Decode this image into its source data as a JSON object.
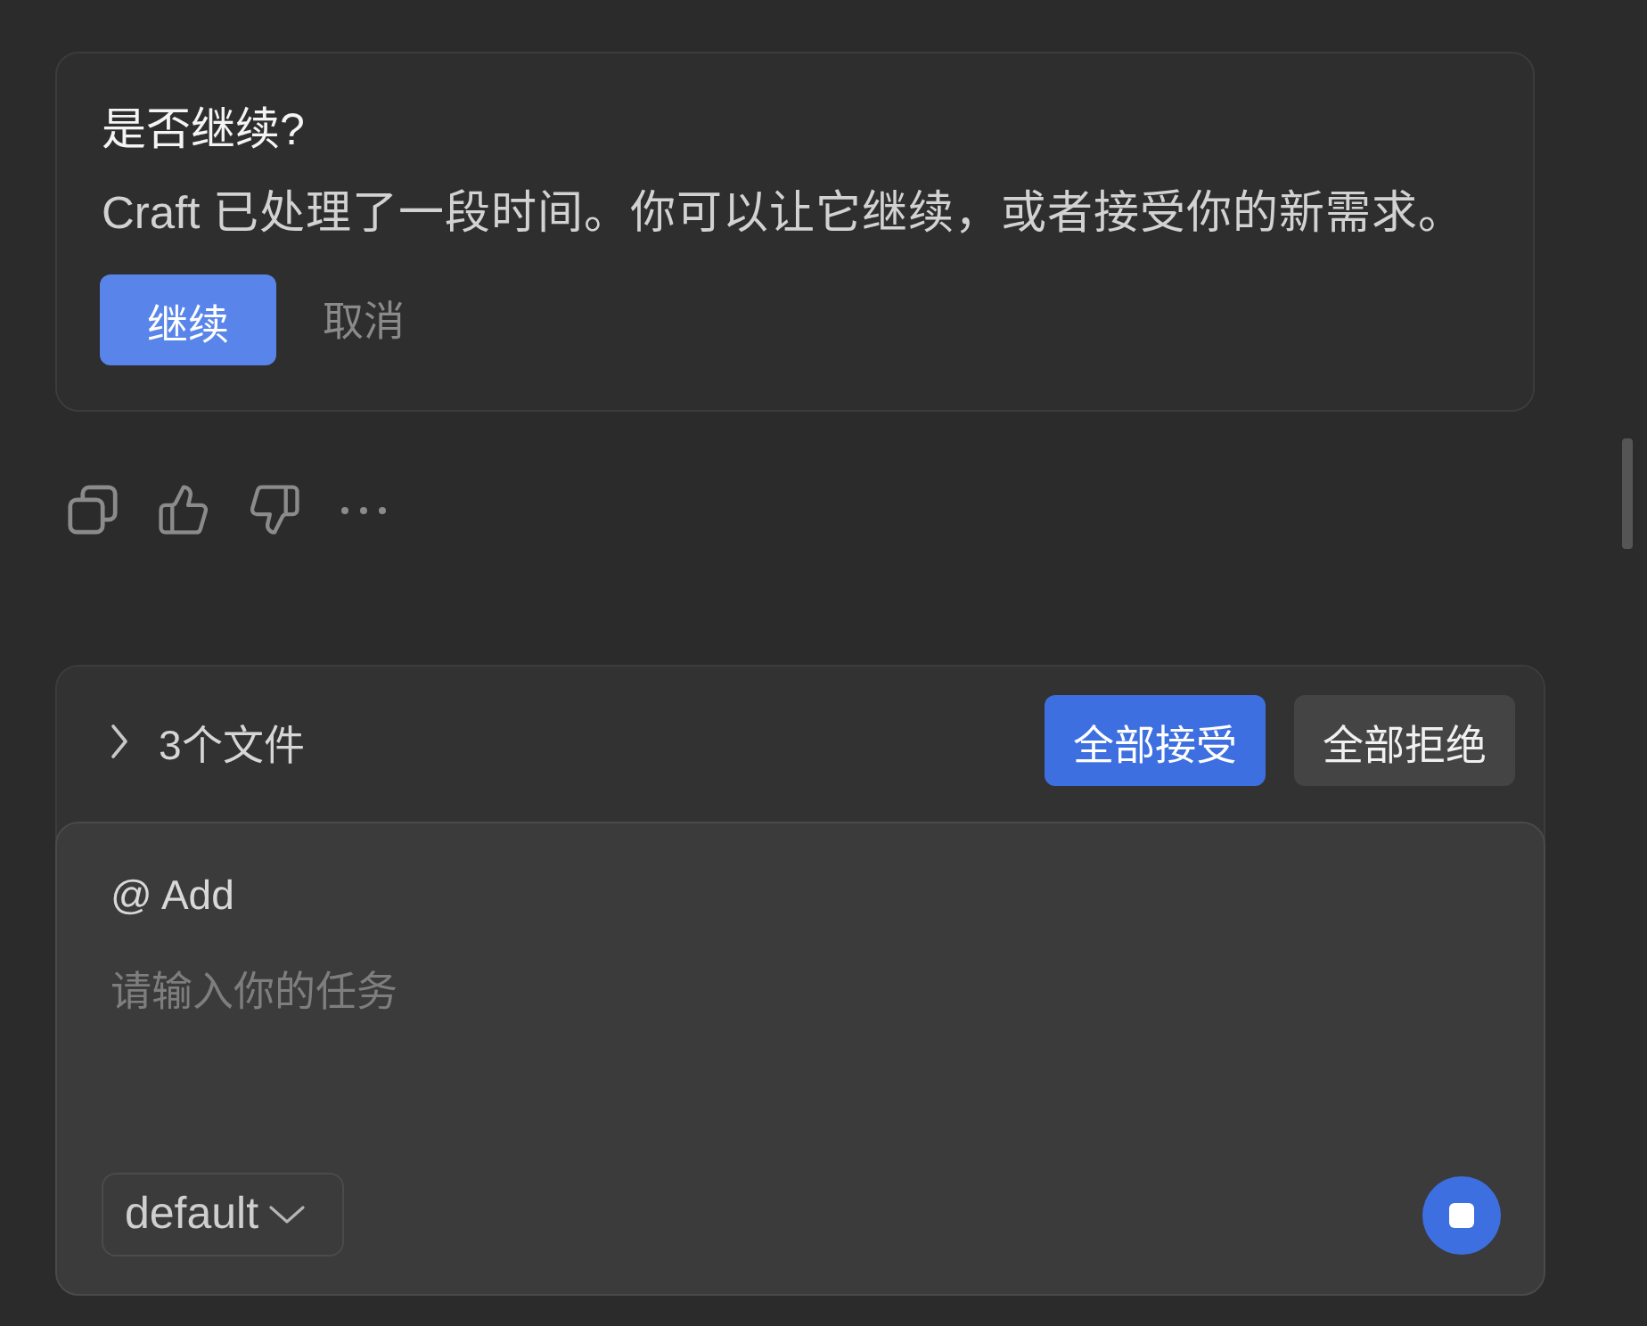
{
  "dialog": {
    "title": "是否继续?",
    "message": "Craft 已处理了一段时间。你可以让它继续，或者接受你的新需求。",
    "buttons": [
      {
        "label": "继续",
        "kind": "primary"
      },
      {
        "label": "取消",
        "kind": "text"
      }
    ]
  },
  "message_actions": [
    {
      "kind": "copy"
    },
    {
      "kind": "thumbs_up"
    },
    {
      "kind": "thumbs_down"
    },
    {
      "kind": "more"
    }
  ],
  "changes": {
    "label": "3个文件",
    "expanded": false,
    "buttons": [
      {
        "label": "全部接受",
        "kind": "primary"
      },
      {
        "label": "全部拒绝",
        "kind": "secondary"
      }
    ]
  },
  "composer": {
    "mention": "@ Add",
    "placeholder": "请输入你的任务",
    "mode": "default",
    "running": true
  }
}
